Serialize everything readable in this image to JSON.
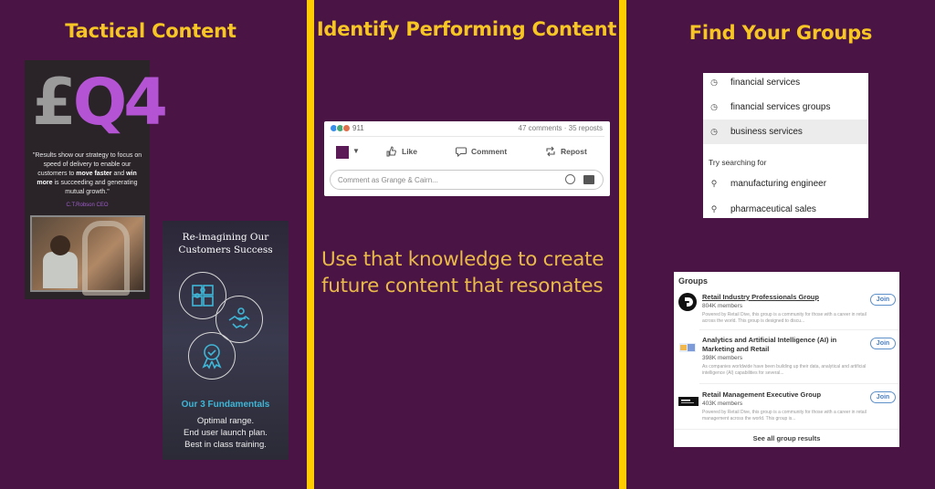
{
  "colors": {
    "background": "#4a1545",
    "divider": "#ffcc00",
    "title": "#f7c624",
    "accent_purple": "#b454d4",
    "accent_cyan": "#3fb6d6",
    "linkedin_blue": "#4a7ebf"
  },
  "columns": [
    {
      "title": "Tactical Content"
    },
    {
      "title": "Identify Performing Content"
    },
    {
      "title": "Find Your Groups"
    }
  ],
  "tactical": {
    "q4_card": {
      "currency": "£",
      "quarter": "Q4",
      "quote_parts": [
        "\"Results show our strategy to focus on speed of delivery to enable our customers to ",
        "move faster",
        " and ",
        "win more",
        " is succeeding and generating mutual growth.\""
      ],
      "signature": "C.T.Robson CEO",
      "photo_alt": "woodworker at bandsaw"
    },
    "customers_card": {
      "title_line1": "Re-imagining Our",
      "title_line2": "Customers Success",
      "icons": [
        "puzzle-icon",
        "handshake-icon",
        "award-icon"
      ],
      "fundamentals_title": "Our 3 Fundamentals",
      "fundamentals": [
        "Optimal range.",
        "End user launch plan.",
        "Best in class training."
      ]
    }
  },
  "performing": {
    "post": {
      "reaction_count": "911",
      "stats": "47 comments · 35 reposts",
      "actions": [
        {
          "label": "Like",
          "icon": "thumbs-up-icon"
        },
        {
          "label": "Comment",
          "icon": "comment-icon"
        },
        {
          "label": "Repost",
          "icon": "repost-icon"
        }
      ],
      "comment_placeholder": "Comment as Grange & Cairn..."
    },
    "message_line1": "Use that knowledge to create",
    "message_line2": "future content that resonates"
  },
  "groups": {
    "search": {
      "recent": [
        "financial services",
        "financial services groups",
        "business services"
      ],
      "highlighted_index": 2,
      "try_heading": "Try searching for",
      "suggestions": [
        "manufacturing engineer",
        "pharmaceutical sales"
      ]
    },
    "results": {
      "heading": "Groups",
      "items": [
        {
          "name": "Retail Industry Professionals Group",
          "members": "804K members",
          "description": "Powered by Retail Dive, this group is a community for those with a career in retail across the world. This group is designed to discu...",
          "join_label": "Join"
        },
        {
          "name": "Analytics and Artificial Intelligence (AI) in Marketing and Retail",
          "members": "398K members",
          "description": "As companies worldwide have been building up their data, analytical and artificial intelligence (AI) capabilities for several...",
          "join_label": "Join"
        },
        {
          "name": "Retail Management Executive Group",
          "members": "403K members",
          "description": "Powered by Retail Dive, this group is a community for those with a career in retail management across the world. This group is...",
          "join_label": "Join"
        }
      ],
      "see_all": "See all group results"
    }
  }
}
